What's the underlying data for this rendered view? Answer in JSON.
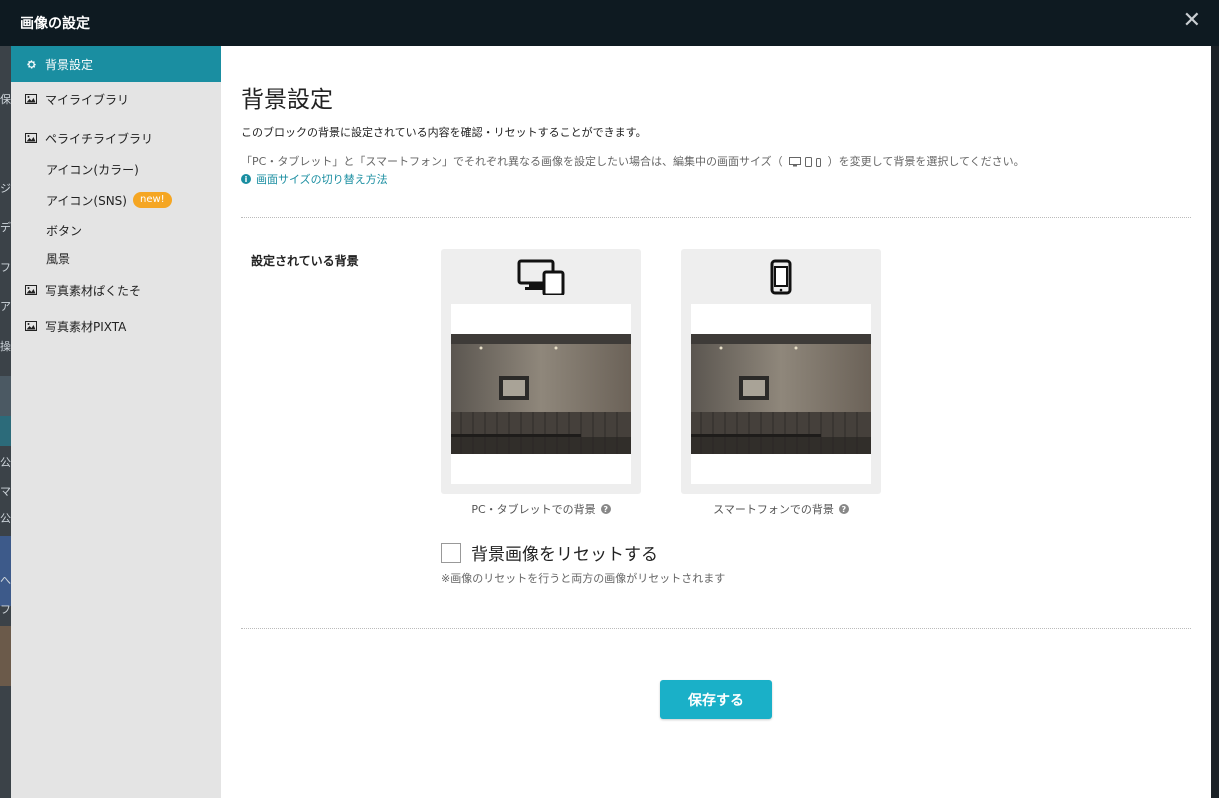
{
  "modal": {
    "title": "画像の設定",
    "close_icon": "close-icon",
    "close_symbol": "✕"
  },
  "sidebar": {
    "items": [
      {
        "label": "背景設定",
        "icon": "gear-icon",
        "active": true
      },
      {
        "label": "マイライブラリ",
        "icon": "image-icon"
      },
      {
        "label": "ペライチライブラリ",
        "icon": "image-icon"
      },
      {
        "label": "写真素材ぱくたそ",
        "icon": "image-icon"
      },
      {
        "label": "写真素材PIXTA",
        "icon": "image-icon"
      }
    ],
    "subitems": [
      {
        "label": "アイコン(カラー)"
      },
      {
        "label": "アイコン(SNS)",
        "badge": "new!"
      },
      {
        "label": "ボタン"
      },
      {
        "label": "風景"
      }
    ]
  },
  "main": {
    "heading": "背景設定",
    "description": "このブロックの背景に設定されている内容を確認・リセットすることができます。",
    "note_before": "「PC・タブレット」と「スマートフォン」でそれぞれ異なる画像を設定したい場合は、編集中の画面サイズ（",
    "note_after": "）を変更して背景を選択してください。",
    "help_link": "画面サイズの切り替え方法",
    "section_label": "設定されている背景",
    "cards": [
      {
        "caption": "PC・タブレットでの背景",
        "icon": "desktop-tablet-icon"
      },
      {
        "caption": "スマートフォンでの背景",
        "icon": "smartphone-icon"
      }
    ],
    "reset_label": "背景画像をリセットする",
    "reset_note": "※画像のリセットを行うと両方の画像がリセットされます",
    "save_button": "保存する"
  },
  "background_page": {
    "fragments": [
      "保",
      "ジ",
      "デ",
      "フ",
      "ア",
      "操",
      "公",
      "マ",
      "公",
      "へ",
      "フ"
    ]
  },
  "colors": {
    "accent": "#1a8ea1",
    "save_button": "#1ab0c8",
    "badge": "#f5a623",
    "titlebar": "#0e1a21"
  }
}
